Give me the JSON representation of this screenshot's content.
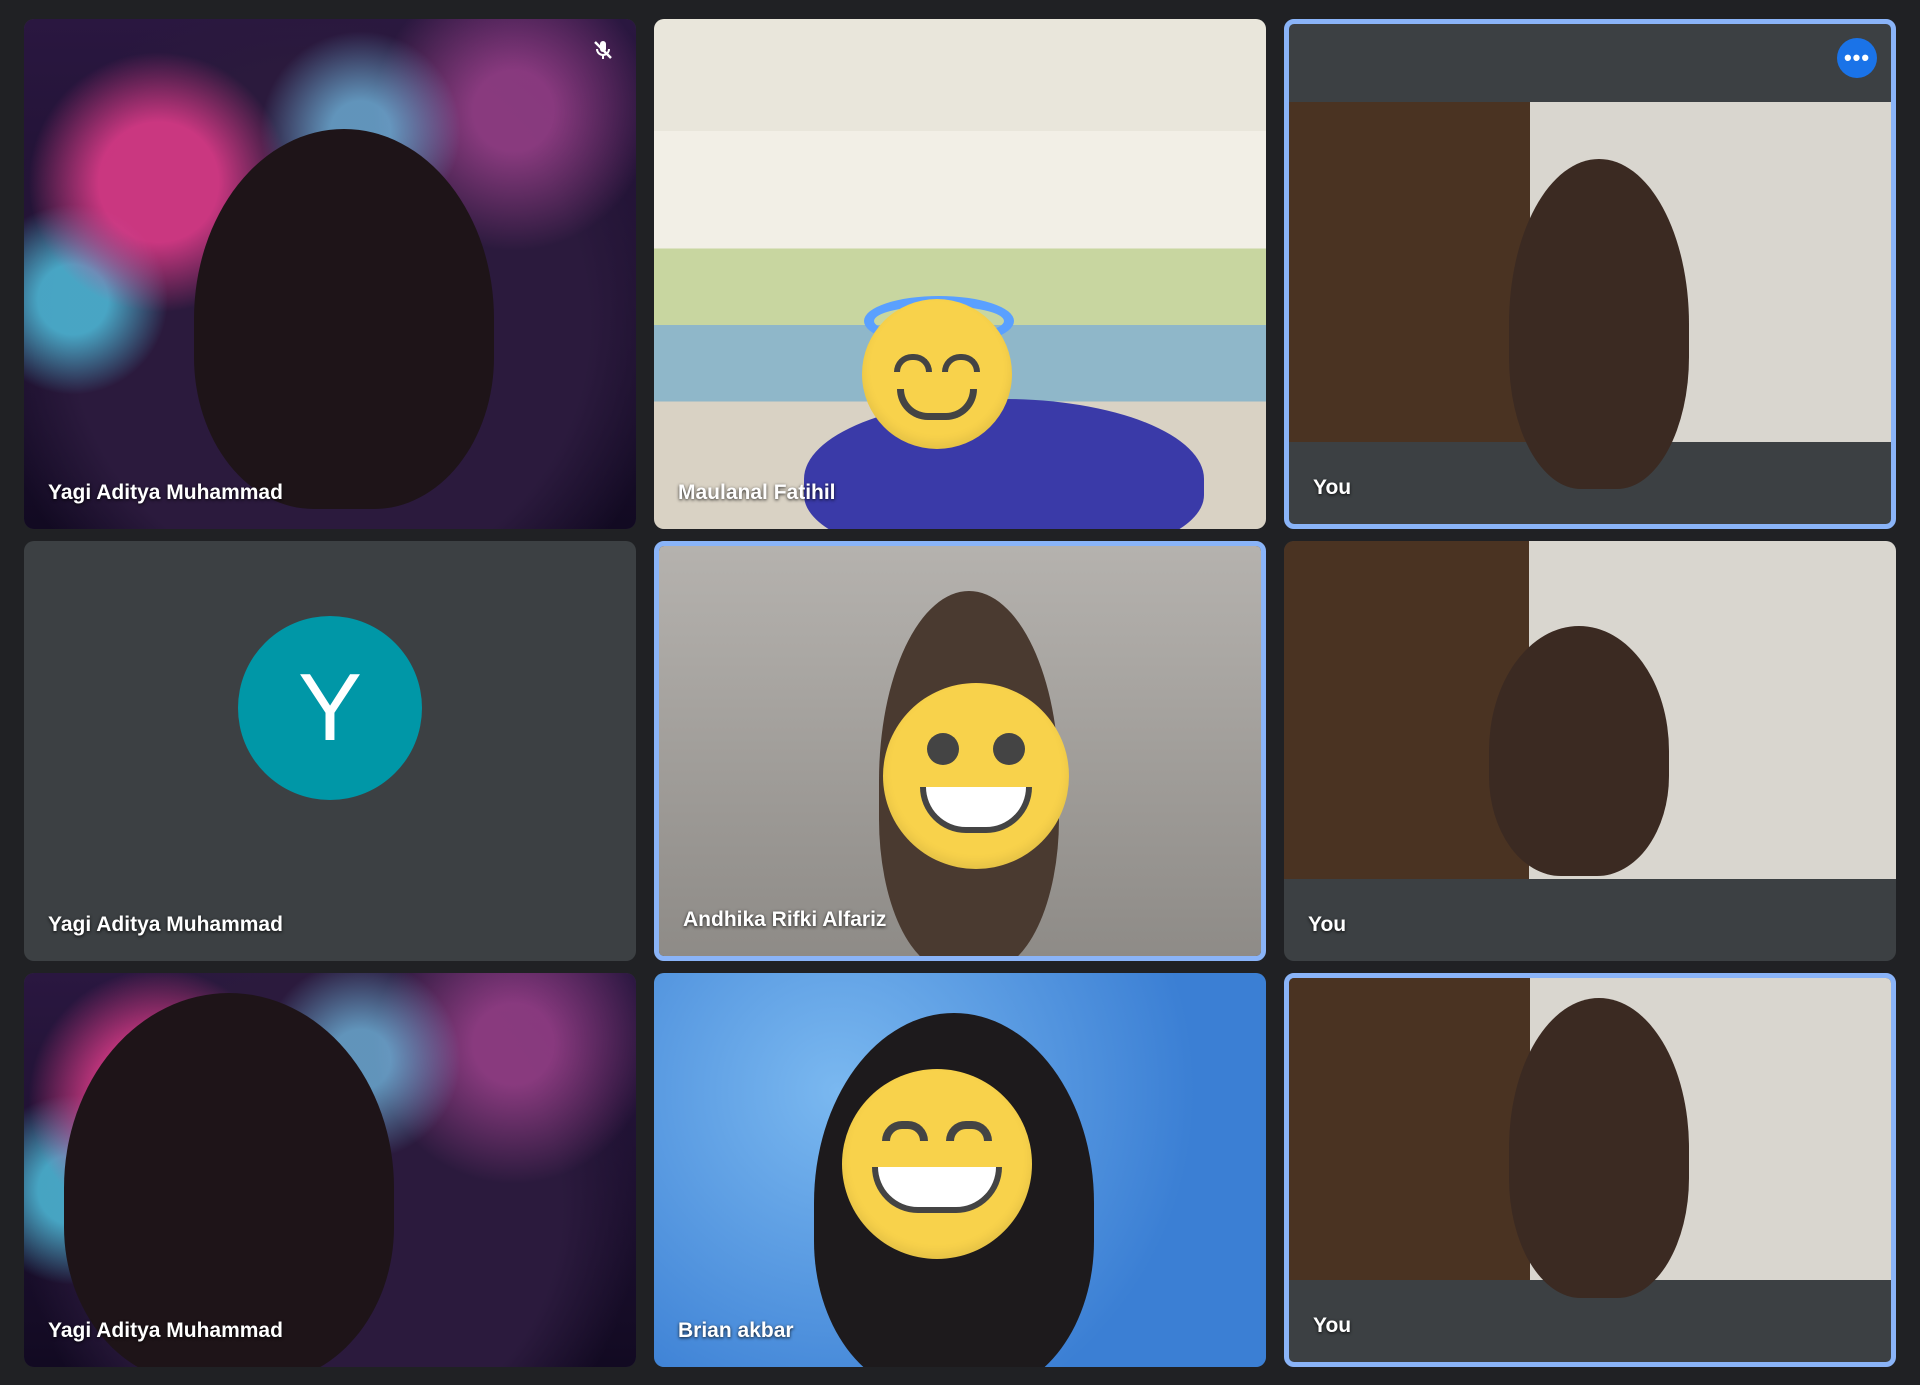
{
  "participants": [
    {
      "name": "Yagi Aditya Muhammad",
      "muted": true,
      "scene": "fireworks"
    },
    {
      "name": "Maulanal Fatihil",
      "scene": "classroom"
    },
    {
      "name": "You",
      "scene": "room",
      "active": true,
      "more_options_icon": "more-horiz-icon"
    },
    {
      "name": "Yagi Aditya Muhammad",
      "avatar_letter": "Y",
      "avatar_color": "#0097a7"
    },
    {
      "name": "Andhika Rifki Alfariz",
      "scene": "gray",
      "active": true
    },
    {
      "name": "You",
      "scene": "room"
    },
    {
      "name": "Yagi Aditya Muhammad",
      "scene": "fireworks"
    },
    {
      "name": "Brian akbar",
      "scene": "blue"
    },
    {
      "name": "You",
      "scene": "room",
      "active": true
    }
  ],
  "colors": {
    "background": "#202124",
    "tile": "#3c4043",
    "active_border": "#8ab4f8",
    "more_button": "#1a73e8",
    "avatar": "#0097a7"
  }
}
